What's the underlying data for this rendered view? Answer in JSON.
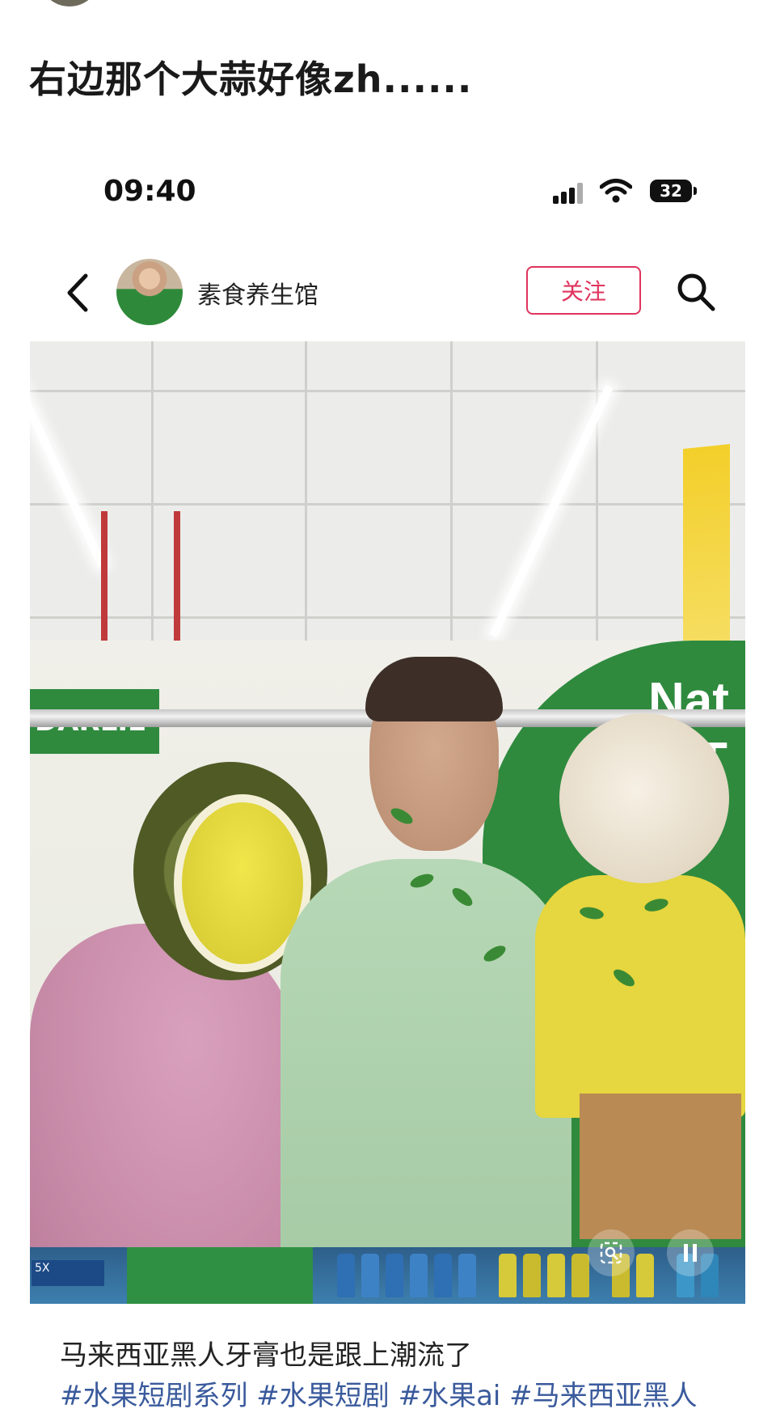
{
  "post": {
    "title": "右边那个大蒜好像zh......"
  },
  "status_bar": {
    "time": "09:40",
    "battery": "32"
  },
  "profile_bar": {
    "account_name": "素食养生馆",
    "follow_label": "关注"
  },
  "photo": {
    "brand_text": "DARLIE",
    "headline_lines": [
      "Nat",
      "T"
    ],
    "shelf_tag": "5X"
  },
  "caption": {
    "text": "马来西亚黑人牙膏也是跟上潮流了",
    "tags": "#水果短剧系列 #水果短剧 #水果ai #马来西亚黑人"
  },
  "icons": [
    "back-chevron-icon",
    "search-icon",
    "signal-icon",
    "wifi-icon",
    "battery-icon",
    "image-search-icon",
    "pause-icon"
  ],
  "colors": {
    "follow_accent": "#e0335d",
    "hashtag": "#3a5a9c",
    "brand_green": "#2f8a3e"
  }
}
